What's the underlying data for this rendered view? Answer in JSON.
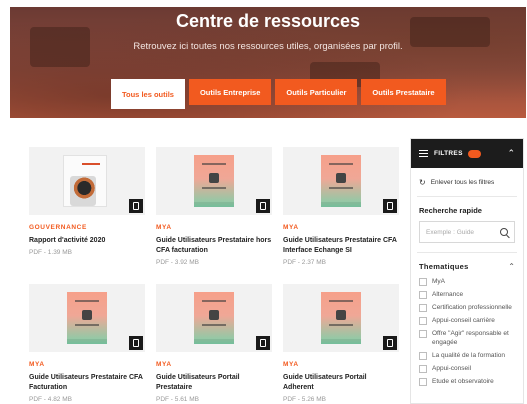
{
  "hero": {
    "title": "Centre de ressources",
    "subtitle": "Retrouvez ici toutes nos ressources utiles, organisées par profil."
  },
  "tabs": [
    {
      "label": "Tous les outils",
      "active": true
    },
    {
      "label": "Outils Entreprise",
      "active": false
    },
    {
      "label": "Outils Particulier",
      "active": false
    },
    {
      "label": "Outils Prestataire",
      "active": false
    }
  ],
  "cards": [
    {
      "category": "GOUVERNANCE",
      "title": "Rapport d'activité 2020",
      "meta": "PDF - 1.39 MB",
      "thumb": "report"
    },
    {
      "category": "MYA",
      "title": "Guide Utilisateurs Prestataire hors CFA facturation",
      "meta": "PDF - 3.92 MB",
      "thumb": "guide"
    },
    {
      "category": "MYA",
      "title": "Guide Utilisateurs Prestataire CFA Interface Echange SI",
      "meta": "PDF - 2.37 MB",
      "thumb": "guide"
    },
    {
      "category": "MYA",
      "title": "Guide Utilisateurs Prestataire CFA Facturation",
      "meta": "PDF - 4.82 MB",
      "thumb": "guide"
    },
    {
      "category": "MYA",
      "title": "Guide Utilisateurs Portail Prestataire",
      "meta": "PDF - 5.61 MB",
      "thumb": "guide"
    },
    {
      "category": "MYA",
      "title": "Guide Utilisateurs Portail Adherent",
      "meta": "PDF - 5.26 MB",
      "thumb": "guide"
    }
  ],
  "filters": {
    "header_label": "FILTRES",
    "reset_label": "Enlever tous les filtres",
    "search_label": "Recherche rapide",
    "search_placeholder": "Exemple : Guide",
    "thematiques_label": "Thematiques",
    "options": [
      "MyA",
      "Alternance",
      "Certification professionnelle",
      "Appui-conseil carrière",
      "Offre \"Agir\" responsable et engagée",
      "La qualité de la formation",
      "Appui-conseil",
      "Etude et observatoire"
    ]
  },
  "colors": {
    "accent": "#f25a1f",
    "dark": "#1c1c1c"
  }
}
